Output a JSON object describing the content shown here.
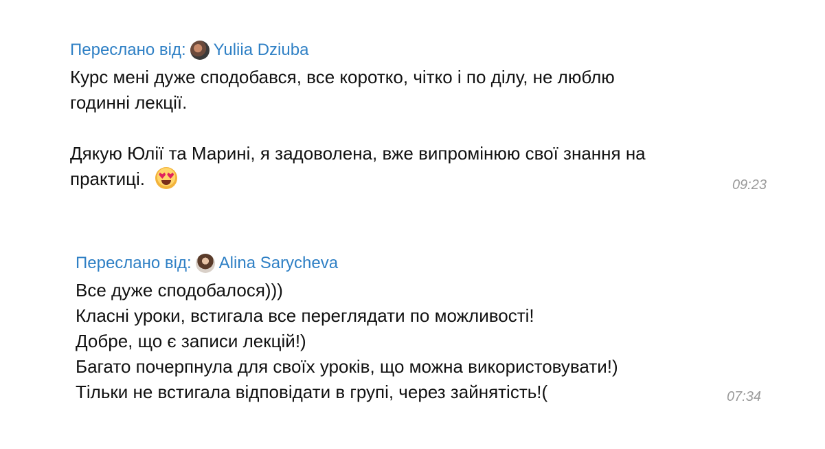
{
  "messages": [
    {
      "forwarded_label": "Переслано від:",
      "author": "Yuliia Dziuba",
      "avatar_icon": "user-avatar-photo",
      "paragraph1": "Курс мені дуже сподобався, все коротко, чітко і по ділу, не люблю години лекції.",
      "paragraph1_line1": "Курс мені дуже сподобався, все коротко, чітко і по ділу, не люблю",
      "paragraph1_line2": "годинні лекції.",
      "paragraph2_line1": "Дякую Юлії та Марині, я задоволена, вже випромінюю свої знання на",
      "paragraph2_line2": "практиці.",
      "emoji": "heart-eyes-emoji",
      "time": "09:23"
    },
    {
      "forwarded_label": "Переслано від:",
      "author": "Alina Sarycheva",
      "avatar_icon": "user-avatar-photo",
      "lines": [
        "Все дуже сподобалося)))",
        "Класні уроки, встигала все переглядати по можливості!",
        "Добре, що є записи лекцій!)",
        "Багато почерпнула для своїх уроків, що можна використовувати!)",
        "Тільки не встигала відповідати в групі, через зайнятість!("
      ],
      "time": "07:34"
    }
  ],
  "colors": {
    "link": "#2f80c5",
    "text": "#111111",
    "time": "#9a9a9a",
    "background": "#ffffff"
  }
}
